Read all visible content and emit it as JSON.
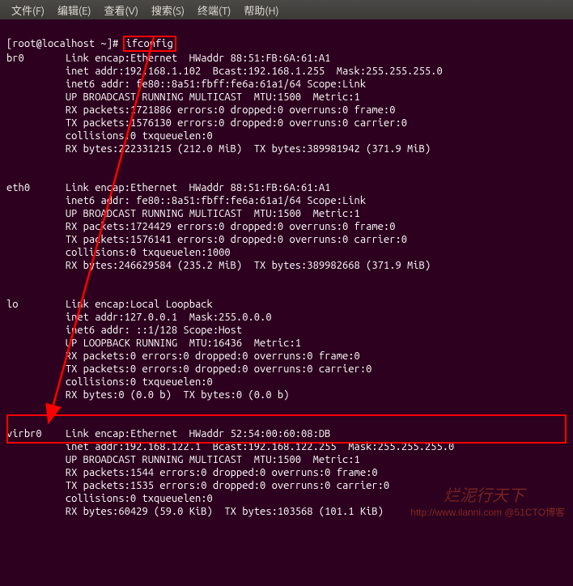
{
  "menubar": {
    "file": "文件(F)",
    "edit": "编辑(E)",
    "view": "查看(V)",
    "search": "搜索(S)",
    "terminal": "终端(T)",
    "help": "帮助(H)"
  },
  "prompt": "[root@localhost ~]# ",
  "command": "ifconfig",
  "interfaces": {
    "br0": {
      "name": "br0",
      "l1": "Link encap:Ethernet  HWaddr 88:51:FB:6A:61:A1",
      "l2": "inet addr:192.168.1.102  Bcast:192.168.1.255  Mask:255.255.255.0",
      "l3": "inet6 addr: fe80::8a51:fbff:fe6a:61a1/64 Scope:Link",
      "l4": "UP BROADCAST RUNNING MULTICAST  MTU:1500  Metric:1",
      "l5": "RX packets:1721886 errors:0 dropped:0 overruns:0 frame:0",
      "l6": "TX packets:1576130 errors:0 dropped:0 overruns:0 carrier:0",
      "l7": "collisions:0 txqueuelen:0",
      "l8": "RX bytes:222331215 (212.0 MiB)  TX bytes:389981942 (371.9 MiB)"
    },
    "eth0": {
      "name": "eth0",
      "l1": "Link encap:Ethernet  HWaddr 88:51:FB:6A:61:A1",
      "l2": "inet6 addr: fe80::8a51:fbff:fe6a:61a1/64 Scope:Link",
      "l3": "UP BROADCAST RUNNING MULTICAST  MTU:1500  Metric:1",
      "l4": "RX packets:1724429 errors:0 dropped:0 overruns:0 frame:0",
      "l5": "TX packets:1576141 errors:0 dropped:0 overruns:0 carrier:0",
      "l6": "collisions:0 txqueuelen:1000",
      "l7": "RX bytes:246629584 (235.2 MiB)  TX bytes:389982668 (371.9 MiB)"
    },
    "lo": {
      "name": "lo",
      "l1": "Link encap:Local Loopback",
      "l2": "inet addr:127.0.0.1  Mask:255.0.0.0",
      "l3": "inet6 addr: ::1/128 Scope:Host",
      "l4": "UP LOOPBACK RUNNING  MTU:16436  Metric:1",
      "l5": "RX packets:0 errors:0 dropped:0 overruns:0 frame:0",
      "l6": "TX packets:0 errors:0 dropped:0 overruns:0 carrier:0",
      "l7": "collisions:0 txqueuelen:0",
      "l8": "RX bytes:0 (0.0 b)  TX bytes:0 (0.0 b)"
    },
    "virbr0": {
      "name": "virbr0",
      "l1": "Link encap:Ethernet  HWaddr 52:54:00:60:08:DB",
      "l2": "inet addr:192.168.122.1  Bcast:192.168.122.255  Mask:255.255.255.0",
      "l3": "UP BROADCAST RUNNING MULTICAST  MTU:1500  Metric:1",
      "l4": "RX packets:1544 errors:0 dropped:0 overruns:0 frame:0",
      "l5": "TX packets:1535 errors:0 dropped:0 overruns:0 carrier:0",
      "l6": "collisions:0 txqueuelen:0",
      "l7": "RX bytes:60429 (59.0 KiB)  TX bytes:103568 (101.1 KiB)"
    }
  },
  "watermark1": "http://www.ilanni.com @51CTO博客",
  "watermark2": "烂泥行天下"
}
